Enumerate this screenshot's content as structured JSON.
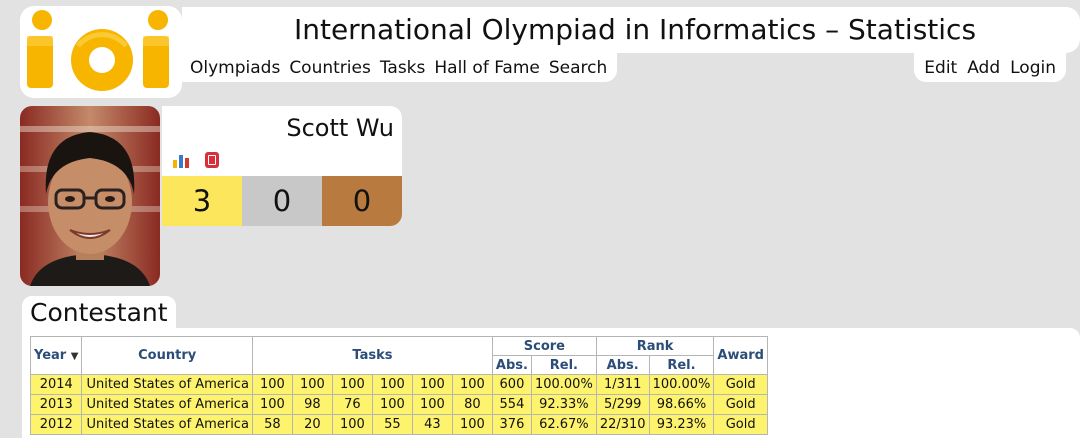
{
  "header": {
    "title": "International Olympiad in Informatics – Statistics",
    "nav": [
      "Olympiads",
      "Countries",
      "Tasks",
      "Hall of Fame",
      "Search"
    ],
    "user_nav": [
      "Edit",
      "Add",
      "Login"
    ]
  },
  "logo": {
    "text": "IOI"
  },
  "profile": {
    "name": "Scott Wu",
    "icons": [
      "bar-chart-icon",
      "phone-card-icon"
    ],
    "medals": {
      "gold": "3",
      "silver": "0",
      "bronze": "0"
    }
  },
  "section": {
    "title": "Contestant",
    "table": {
      "headers": {
        "year": "Year",
        "sort_indicator": "▼",
        "country": "Country",
        "tasks": "Tasks",
        "score": "Score",
        "rank": "Rank",
        "award": "Award",
        "abs": "Abs.",
        "rel": "Rel."
      },
      "rows": [
        {
          "year": "2014",
          "country": "United States of America",
          "tasks": [
            "100",
            "100",
            "100",
            "100",
            "100",
            "100"
          ],
          "score_abs": "600",
          "score_rel": "100.00%",
          "rank_abs": "1/311",
          "rank_rel": "100.00%",
          "award": "Gold"
        },
        {
          "year": "2013",
          "country": "United States of America",
          "tasks": [
            "100",
            "98",
            "76",
            "100",
            "100",
            "80"
          ],
          "score_abs": "554",
          "score_rel": "92.33%",
          "rank_abs": "5/299",
          "rank_rel": "98.66%",
          "award": "Gold"
        },
        {
          "year": "2012",
          "country": "United States of America",
          "tasks": [
            "58",
            "20",
            "100",
            "55",
            "43",
            "100"
          ],
          "score_abs": "376",
          "score_rel": "62.67%",
          "rank_abs": "22/310",
          "rank_rel": "93.23%",
          "award": "Gold"
        }
      ]
    }
  },
  "colors": {
    "gold": "#fce75c",
    "silver": "#c8c8c8",
    "bronze": "#b87a3e",
    "logo": "#f7b500",
    "header_text": "#2b4d78",
    "row_bg": "#fdf36d"
  }
}
